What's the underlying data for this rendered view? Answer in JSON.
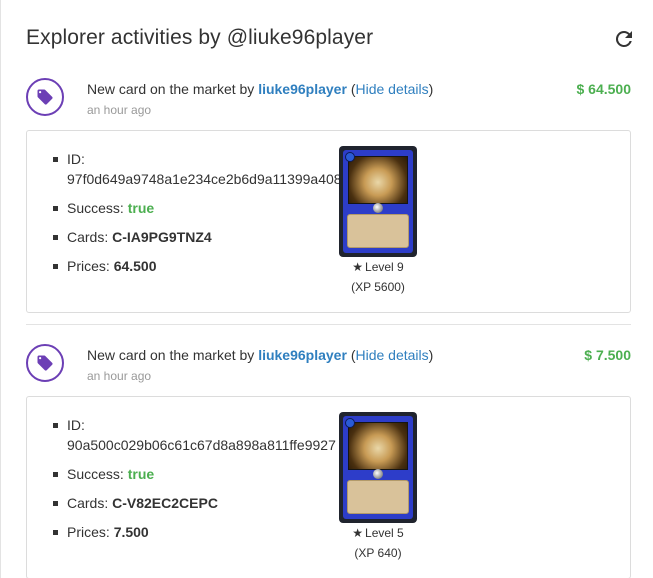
{
  "header": {
    "title": "Explorer activities by @liuke96player",
    "refresh_icon": "refresh-icon"
  },
  "activities": [
    {
      "text_prefix": "New card on the market by",
      "user": "liuke96player",
      "paren_open": "(",
      "toggle_label": "Hide details",
      "paren_close": ")",
      "time": "an hour ago",
      "amount": "$ 64.500",
      "details": {
        "id_label": "ID:",
        "id_value": "97f0d649a9748a1e234ce2b6d9a11399a408",
        "success_label": "Success:",
        "success_value": "true",
        "cards_label": "Cards:",
        "cards_value": "C-IA9PG9TNZ4",
        "prices_label": "Prices:",
        "prices_value": "64.500",
        "level": "Level 9",
        "xp": "(XP 5600)"
      }
    },
    {
      "text_prefix": "New card on the market by",
      "user": "liuke96player",
      "paren_open": "(",
      "toggle_label": "Hide details",
      "paren_close": ")",
      "time": "an hour ago",
      "amount": "$ 7.500",
      "details": {
        "id_label": "ID:",
        "id_value": "90a500c029b06c61c67d8a898a811ffe9927",
        "success_label": "Success:",
        "success_value": "true",
        "cards_label": "Cards:",
        "cards_value": "C-V82EC2CEPC",
        "prices_label": "Prices:",
        "prices_value": "7.500",
        "level": "Level 5",
        "xp": "(XP 640)"
      }
    }
  ],
  "colors": {
    "accent": "#6c3fb5",
    "link": "#2f7fbf",
    "success": "#4caf50"
  }
}
